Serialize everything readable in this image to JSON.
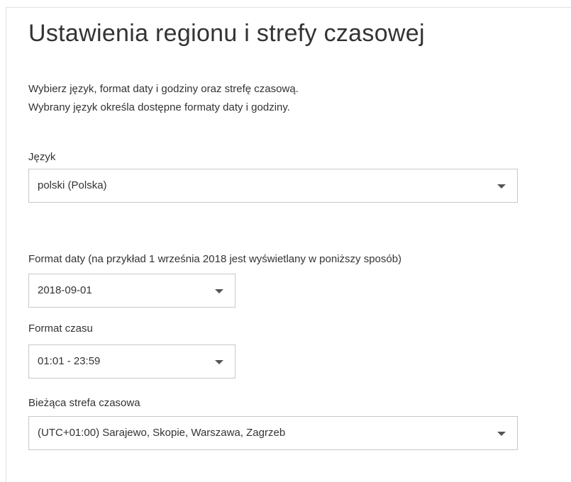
{
  "page": {
    "title": "Ustawienia regionu i strefy czasowej",
    "description_line1": "Wybierz język, format daty i godziny oraz strefę czasową.",
    "description_line2": "Wybrany język określa dostępne formaty daty i godziny."
  },
  "language": {
    "label": "Język",
    "value": "polski (Polska)",
    "icon": "chevron-down-icon"
  },
  "date_format": {
    "label": "Format daty (na przykład 1 września 2018 jest wyświetlany w poniższy sposób)",
    "value": "2018-09-01",
    "icon": "chevron-down-icon"
  },
  "time_format": {
    "label": "Format czasu",
    "value": "01:01 - 23:59",
    "icon": "chevron-down-icon"
  },
  "time_zone": {
    "label": "Bieżąca strefa czasowa",
    "value": "(UTC+01:00) Sarajewo, Skopie, Warszawa, Zagrzeb",
    "icon": "chevron-down-icon"
  }
}
